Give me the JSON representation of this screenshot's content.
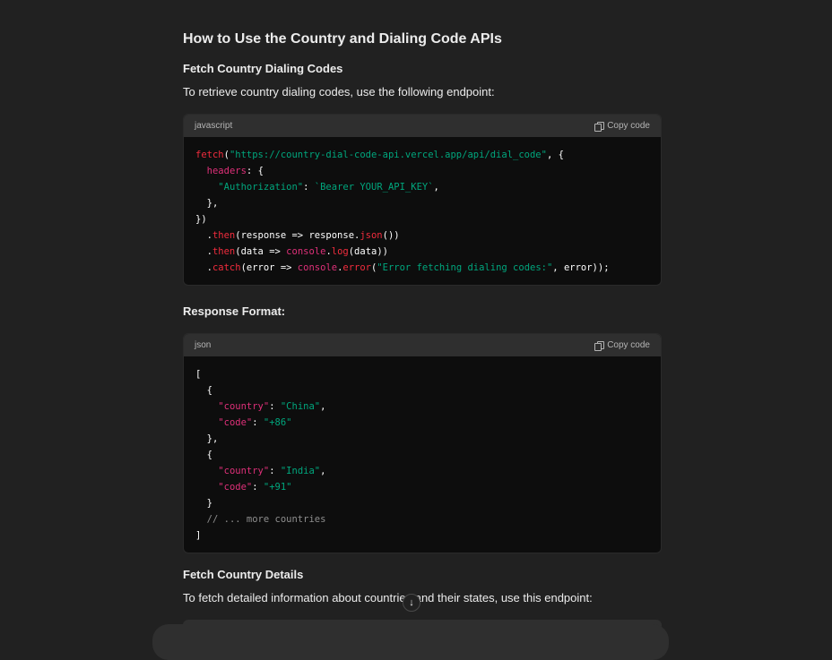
{
  "title": "How to Use the Country and Dialing Code APIs",
  "section1": {
    "heading": "Fetch Country Dialing Codes",
    "paragraph": "To retrieve country dialing codes, use the following endpoint:"
  },
  "code1": {
    "language": "javascript",
    "copy_label": "Copy code",
    "lines": [
      [
        [
          "red",
          "fetch"
        ],
        [
          "plain",
          "("
        ],
        [
          "green",
          "\"https://country-dial-code-api.vercel.app/api/dial_code\""
        ],
        [
          "plain",
          ", {"
        ]
      ],
      [
        [
          "plain",
          "  "
        ],
        [
          "pink",
          "headers"
        ],
        [
          "plain",
          ": {"
        ]
      ],
      [
        [
          "plain",
          "    "
        ],
        [
          "green",
          "\"Authorization\""
        ],
        [
          "plain",
          ": "
        ],
        [
          "green",
          "`Bearer YOUR_API_KEY`"
        ],
        [
          "plain",
          ","
        ]
      ],
      [
        [
          "plain",
          "  },"
        ]
      ],
      [
        [
          "plain",
          "})"
        ]
      ],
      [
        [
          "plain",
          "  ."
        ],
        [
          "red",
          "then"
        ],
        [
          "plain",
          "(response => response."
        ],
        [
          "red",
          "json"
        ],
        [
          "plain",
          "())"
        ]
      ],
      [
        [
          "plain",
          "  ."
        ],
        [
          "red",
          "then"
        ],
        [
          "plain",
          "(data => "
        ],
        [
          "pink",
          "console"
        ],
        [
          "plain",
          "."
        ],
        [
          "red",
          "log"
        ],
        [
          "plain",
          "(data))"
        ]
      ],
      [
        [
          "plain",
          "  ."
        ],
        [
          "red",
          "catch"
        ],
        [
          "plain",
          "(error => "
        ],
        [
          "pink",
          "console"
        ],
        [
          "plain",
          "."
        ],
        [
          "red",
          "error"
        ],
        [
          "plain",
          "("
        ],
        [
          "green",
          "\"Error fetching dialing codes:\""
        ],
        [
          "plain",
          ", error));"
        ]
      ]
    ]
  },
  "response_heading": "Response Format:",
  "code2": {
    "language": "json",
    "copy_label": "Copy code",
    "lines": [
      [
        [
          "plain",
          "["
        ]
      ],
      [
        [
          "plain",
          "  {"
        ]
      ],
      [
        [
          "plain",
          "    "
        ],
        [
          "pink",
          "\"country\""
        ],
        [
          "plain",
          ": "
        ],
        [
          "green",
          "\"China\""
        ],
        [
          "plain",
          ","
        ]
      ],
      [
        [
          "plain",
          "    "
        ],
        [
          "pink",
          "\"code\""
        ],
        [
          "plain",
          ": "
        ],
        [
          "green",
          "\"+86\""
        ]
      ],
      [
        [
          "plain",
          "  },"
        ]
      ],
      [
        [
          "plain",
          "  {"
        ]
      ],
      [
        [
          "plain",
          "    "
        ],
        [
          "pink",
          "\"country\""
        ],
        [
          "plain",
          ": "
        ],
        [
          "green",
          "\"India\""
        ],
        [
          "plain",
          ","
        ]
      ],
      [
        [
          "plain",
          "    "
        ],
        [
          "pink",
          "\"code\""
        ],
        [
          "plain",
          ": "
        ],
        [
          "green",
          "\"+91\""
        ]
      ],
      [
        [
          "plain",
          "  }"
        ]
      ],
      [
        [
          "plain",
          "  "
        ],
        [
          "comment",
          "// ... more countries"
        ]
      ],
      [
        [
          "plain",
          "]"
        ]
      ]
    ]
  },
  "section2": {
    "heading": "Fetch Country Details",
    "paragraph": "To fetch detailed information about countries and their states, use this endpoint:"
  },
  "scroll_button_icon": "arrow-down-icon",
  "scroll_button_glyph": "↓",
  "colors": {
    "background": "#212121",
    "code_bg": "#0d0d0d",
    "code_header": "#2f2f2f",
    "red": "#f22c3d",
    "pink": "#df3079",
    "green": "#00a67d"
  }
}
